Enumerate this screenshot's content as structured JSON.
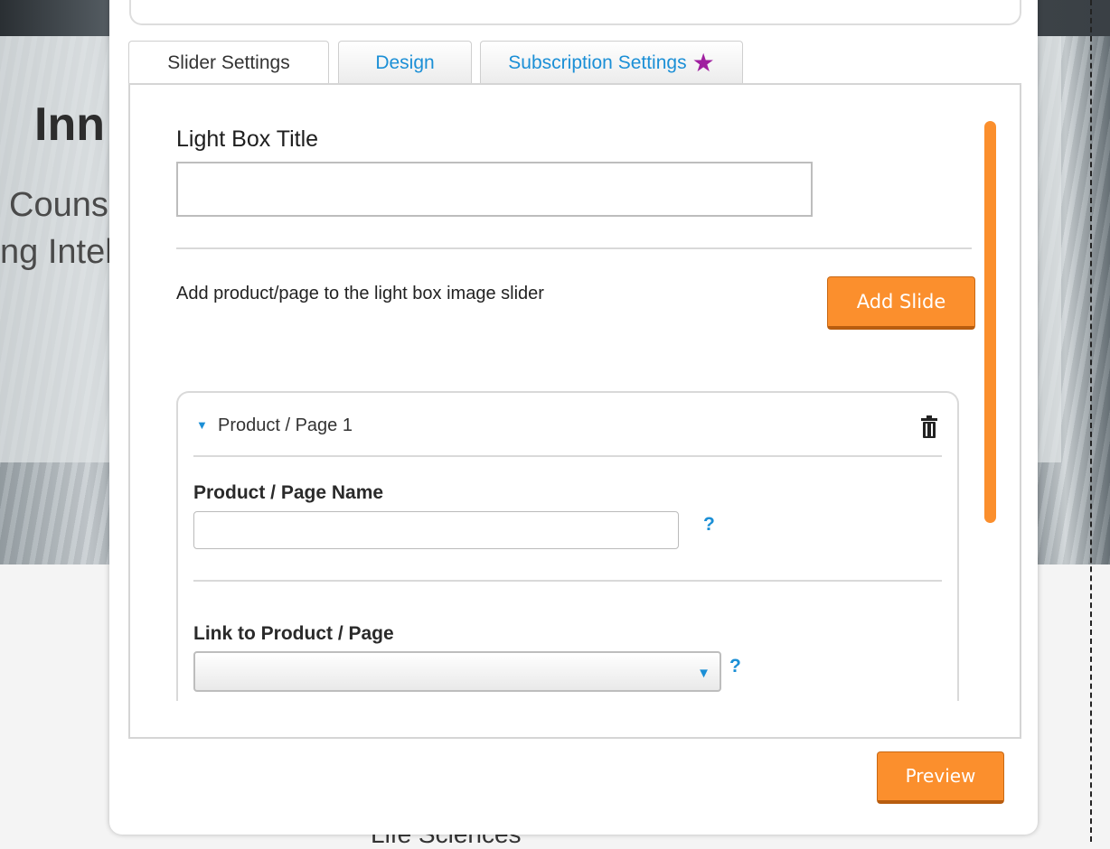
{
  "background": {
    "heading": "Inn",
    "line1": "Couns",
    "line2": "ng Intel",
    "bottom_text": "Life Sciences"
  },
  "tabs": [
    {
      "label": "Slider Settings",
      "active": true
    },
    {
      "label": "Design",
      "active": false
    },
    {
      "label": "Subscription Settings",
      "active": false,
      "badge": "★"
    }
  ],
  "light_box": {
    "title_label": "Light Box Title",
    "title_value": ""
  },
  "slider": {
    "description": "Add product/page to the light box image slider",
    "add_button": "Add Slide"
  },
  "slide": {
    "header": "Product / Page 1",
    "name_label": "Product / Page Name",
    "name_value": "",
    "link_label": "Link to Product / Page",
    "link_value": "",
    "help": "?"
  },
  "footer": {
    "preview_button": "Preview"
  },
  "colors": {
    "accent": "#fb8f2d",
    "link": "#1b8fd6",
    "star": "#a020a0"
  }
}
